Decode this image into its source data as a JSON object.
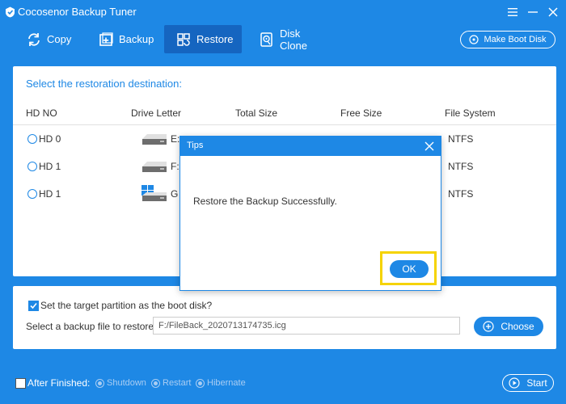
{
  "app": {
    "title": "Cocosenor Backup Tuner"
  },
  "toolbar": {
    "items": [
      {
        "label": "Copy",
        "icon": "copy-refresh-icon"
      },
      {
        "label": "Backup",
        "icon": "backup-plus-icon"
      },
      {
        "label": "Restore",
        "icon": "restore-grid-icon",
        "active": true
      },
      {
        "label": "Disk Clone",
        "icon": "disk-clone-icon"
      }
    ],
    "boot_disk_label": "Make Boot Disk"
  },
  "restore_panel": {
    "title": "Select the restoration destination:",
    "columns": [
      "HD NO",
      "Drive Letter",
      "Total Size",
      "Free Size",
      "File System"
    ],
    "rows": [
      {
        "hd": "HD 0",
        "letter": "E:",
        "drive_icon": "hard-drive-icon",
        "fs": "NTFS"
      },
      {
        "hd": "HD 1",
        "letter": "F:",
        "drive_icon": "hard-drive-icon",
        "fs": "NTFS"
      },
      {
        "hd": "HD 1",
        "letter": "G",
        "drive_icon": "windows-drive-icon",
        "fs": "NTFS"
      }
    ]
  },
  "options": {
    "boot_partition_label": "Set the target partition as the boot disk?",
    "boot_partition_checked": true,
    "file_label": "Select a backup file to restore:",
    "file_value": "F:/FileBack_2020713174735.icg",
    "choose_label": "Choose"
  },
  "footer": {
    "after_label": "After Finished:",
    "after_checked": false,
    "choices": [
      "Shutdown",
      "Restart",
      "Hibernate"
    ],
    "start_label": "Start"
  },
  "dialog": {
    "title": "Tips",
    "message": "Restore the Backup Successfully.",
    "ok_label": "OK"
  },
  "colors": {
    "brand": "#1e88e5",
    "highlight": "#f5d300"
  }
}
